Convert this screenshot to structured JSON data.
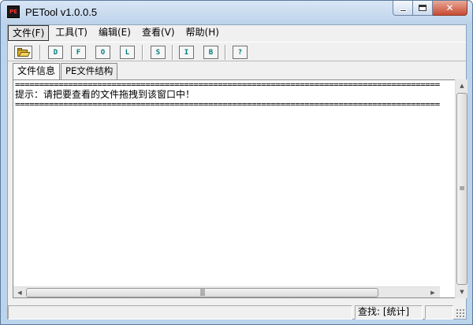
{
  "window": {
    "icon_text": "PE",
    "title": "PETool v1.0.0.5",
    "close_glyph": "✕"
  },
  "menu": [
    {
      "label": "文件(F)"
    },
    {
      "label": "工具(T)"
    },
    {
      "label": "编辑(E)"
    },
    {
      "label": "查看(V)"
    },
    {
      "label": "帮助(H)"
    }
  ],
  "toolbar": {
    "buttons": [
      "D",
      "F",
      "O",
      "L",
      "S",
      "I",
      "B",
      "?"
    ]
  },
  "tabs": [
    {
      "label": "文件信息"
    },
    {
      "label": "PE文件结构"
    }
  ],
  "content": {
    "separator": "===================================================================================================",
    "hint": "提示：请把要查看的文件拖拽到该窗口中！"
  },
  "status": {
    "find_label": "查找: [统计]"
  },
  "icons": {
    "open": "folder-open-icon",
    "scroll_up": "▲",
    "scroll_down": "▼",
    "scroll_left": "◀",
    "scroll_right": "▶",
    "grip": "≡",
    "hgrip": "|||"
  },
  "colors": {
    "toolbar_letter": "#007a7a",
    "titlebar": "#bcd2ea"
  }
}
